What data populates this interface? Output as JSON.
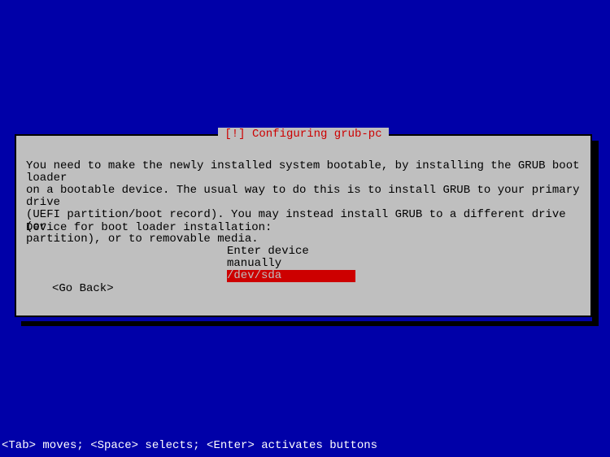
{
  "dialog": {
    "title": "[!] Configuring grub-pc",
    "body": "You need to make the newly installed system bootable, by installing the GRUB boot loader\non a bootable device. The usual way to do this is to install GRUB to your primary drive\n(UEFI partition/boot record). You may instead install GRUB to a different drive (or\npartition), or to removable media.",
    "prompt": "Device for boot loader installation:",
    "options": {
      "manual": "Enter device manually",
      "sda": "/dev/sda"
    },
    "goBack": "<Go Back>"
  },
  "footer": {
    "hints": "<Tab> moves; <Space> selects; <Enter> activates buttons"
  }
}
